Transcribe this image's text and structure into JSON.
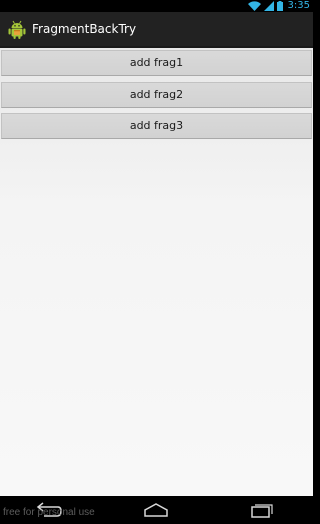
{
  "status_bar": {
    "time": "3:35",
    "clock_color": "#33b5e5",
    "icons": [
      "wifi-icon",
      "signal-icon",
      "battery-icon"
    ]
  },
  "action_bar": {
    "app_icon": "android-robot-icon",
    "title": "FragmentBackTry",
    "background": "#222222"
  },
  "buttons": [
    {
      "label": "add frag1"
    },
    {
      "label": "add frag2"
    },
    {
      "label": "add frag3"
    }
  ],
  "nav_bar": {
    "buttons": [
      "back-icon",
      "home-icon",
      "recent-apps-icon"
    ]
  },
  "watermark": "free for personal use"
}
